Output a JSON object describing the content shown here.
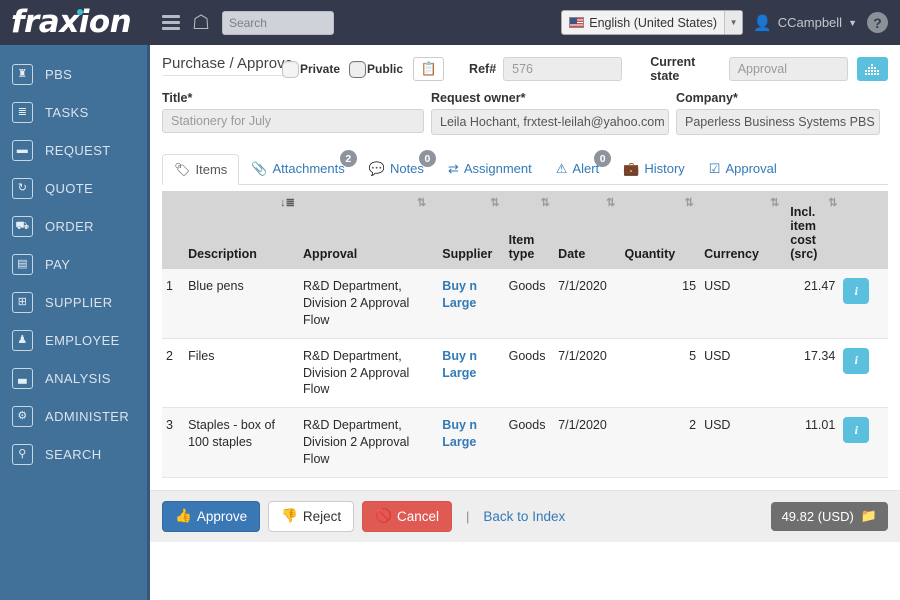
{
  "header": {
    "logo_text": "fraxion",
    "menu_icon": "hamburger-icon",
    "home_icon": "home-icon",
    "search_placeholder": "Search",
    "language": "English (United States)",
    "user_name": "CCampbell",
    "help_label": "?"
  },
  "sidebar": {
    "items": [
      {
        "label": "PBS",
        "glyph": "♜"
      },
      {
        "label": "TASKS",
        "glyph": "≣"
      },
      {
        "label": "REQUEST",
        "glyph": "▬"
      },
      {
        "label": "QUOTE",
        "glyph": "↻"
      },
      {
        "label": "ORDER",
        "glyph": "⛟"
      },
      {
        "label": "PAY",
        "glyph": "▤"
      },
      {
        "label": "SUPPLIER",
        "glyph": "⊞"
      },
      {
        "label": "EMPLOYEE",
        "glyph": "♟"
      },
      {
        "label": "ANALYSIS",
        "glyph": "▃"
      },
      {
        "label": "ADMINISTER",
        "glyph": "⚙"
      },
      {
        "label": "SEARCH",
        "glyph": "⚲"
      }
    ]
  },
  "form": {
    "page_title": "Purchase / Approve",
    "private_label": "Private",
    "public_label": "Public",
    "private_selected": false,
    "public_selected": true,
    "clipboard_icon": "clipboard-add-icon",
    "ref_label": "Ref#",
    "ref_value": "576",
    "state_label": "Current state",
    "state_value": "Approval",
    "grid_button_icon": "sitemap-icon",
    "title_label": "Title*",
    "title_placeholder": "Stationery for July",
    "owner_label": "Request owner*",
    "owner_value": "Leila Hochant, frxtest-leilah@yahoo.com",
    "company_label": "Company*",
    "company_value": "Paperless Business Systems PBS"
  },
  "tabs": [
    {
      "label": "Items",
      "icon": "tag-icon",
      "badge": null,
      "active": true
    },
    {
      "label": "Attachments",
      "icon": "paperclip-icon",
      "badge": "2",
      "active": false
    },
    {
      "label": "Notes",
      "icon": "comment-icon",
      "badge": "0",
      "active": false
    },
    {
      "label": "Assignment",
      "icon": "exchange-icon",
      "badge": null,
      "active": false
    },
    {
      "label": "Alert",
      "icon": "warning-icon",
      "badge": "0",
      "active": false
    },
    {
      "label": "History",
      "icon": "briefcase-icon",
      "badge": null,
      "active": false
    },
    {
      "label": "Approval",
      "icon": "check-square-icon",
      "badge": null,
      "active": false
    }
  ],
  "table": {
    "columns": [
      "Description",
      "Approval",
      "Supplier",
      "Item type",
      "Date",
      "Quantity",
      "Currency",
      "Incl. item cost (src)"
    ],
    "rows": [
      {
        "index": "1",
        "description": "Blue pens",
        "approval": "R&D Department, Division 2 Approval Flow",
        "supplier": "Buy n Large",
        "item_type": "Goods",
        "date": "7/1/2020",
        "quantity": "15",
        "currency": "USD",
        "cost": "21.47"
      },
      {
        "index": "2",
        "description": "Files",
        "approval": "R&D Department, Division 2 Approval Flow",
        "supplier": "Buy n Large",
        "item_type": "Goods",
        "date": "7/1/2020",
        "quantity": "5",
        "currency": "USD",
        "cost": "17.34"
      },
      {
        "index": "3",
        "description": "Staples - box of 100 staples",
        "approval": "R&D Department, Division 2 Approval Flow",
        "supplier": "Buy n Large",
        "item_type": "Goods",
        "date": "7/1/2020",
        "quantity": "2",
        "currency": "USD",
        "cost": "11.01"
      }
    ]
  },
  "actions": {
    "approve_label": "Approve",
    "reject_label": "Reject",
    "cancel_label": "Cancel",
    "separator": "|",
    "back_label": "Back to Index",
    "total_label": "49.82 (USD)"
  },
  "colors": {
    "header_bg": "#343a4b",
    "sidebar_bg": "#417099",
    "accent_blue": "#337ab7",
    "info_blue": "#5bc0de",
    "danger_red": "#e05a54",
    "logo_dot": "#36c0d8"
  }
}
